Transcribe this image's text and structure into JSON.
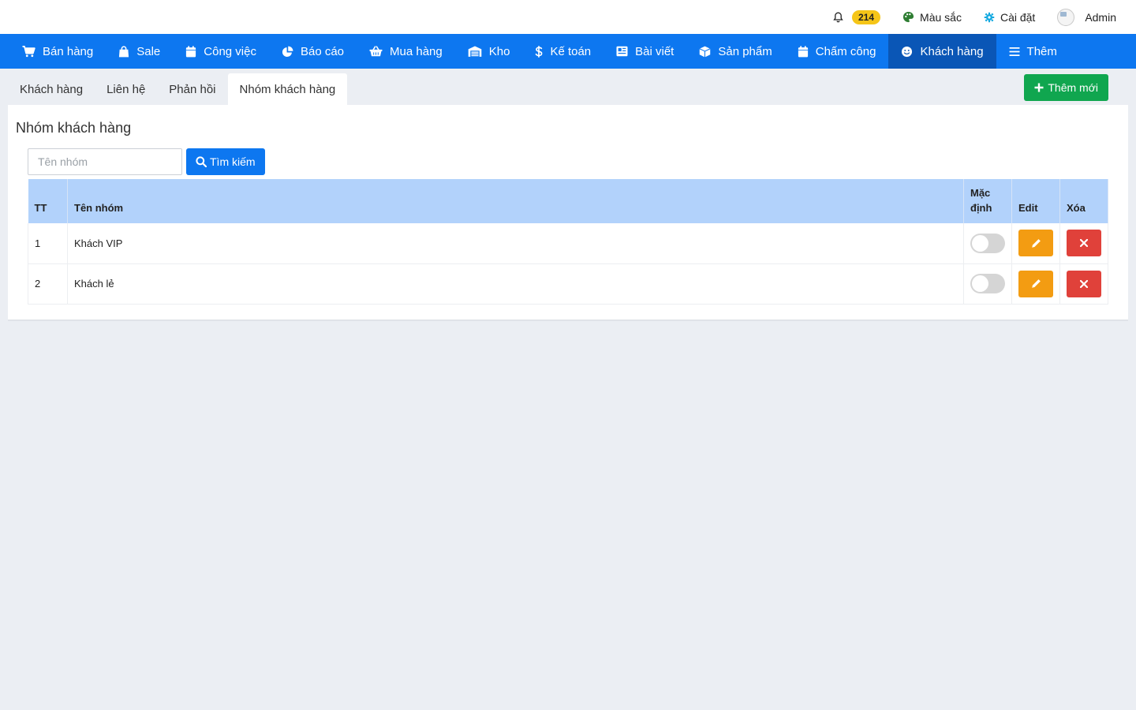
{
  "topbar": {
    "notifications_count": "214",
    "colors_label": "Màu sắc",
    "settings_label": "Cài đặt",
    "user_name": "Admin"
  },
  "mainnav": {
    "items": [
      {
        "label": "Bán hàng",
        "icon": "cart-icon"
      },
      {
        "label": "Sale",
        "icon": "bag-icon"
      },
      {
        "label": "Công việc",
        "icon": "calendar-icon"
      },
      {
        "label": "Báo cáo",
        "icon": "pie-chart-icon"
      },
      {
        "label": "Mua hàng",
        "icon": "basket-icon"
      },
      {
        "label": "Kho",
        "icon": "warehouse-icon"
      },
      {
        "label": "Kế toán",
        "icon": "dollar-icon"
      },
      {
        "label": "Bài viết",
        "icon": "article-icon"
      },
      {
        "label": "Sản phẩm",
        "icon": "box-icon"
      },
      {
        "label": "Chấm công",
        "icon": "calendar-icon"
      },
      {
        "label": "Khách hàng",
        "icon": "smile-icon",
        "active": true
      },
      {
        "label": "Thêm",
        "icon": "menu-icon"
      }
    ]
  },
  "subtabs": {
    "items": [
      {
        "label": "Khách hàng"
      },
      {
        "label": "Liên hệ"
      },
      {
        "label": "Phản hồi"
      },
      {
        "label": "Nhóm khách hàng",
        "active": true
      }
    ],
    "add_label": "Thêm mới"
  },
  "panel": {
    "title": "Nhóm khách hàng",
    "search_placeholder": "Tên nhóm",
    "search_value": "",
    "search_button": "Tìm kiếm"
  },
  "table": {
    "headers": {
      "tt": "TT",
      "name": "Tên nhóm",
      "default_line1": "Mặc",
      "default_line2": "định",
      "edit": "Edit",
      "delete": "Xóa"
    },
    "rows": [
      {
        "tt": "1",
        "name": "Khách VIP",
        "default": false
      },
      {
        "tt": "2",
        "name": "Khách lẻ",
        "default": false
      }
    ]
  },
  "colors": {
    "nav_bg": "#0d77f0",
    "nav_active_bg": "#0a56b6",
    "add_button": "#10a64f",
    "edit_button": "#f39c12",
    "delete_button": "#e0413a",
    "table_header": "#b2d2fb",
    "badge": "#f5c518"
  }
}
